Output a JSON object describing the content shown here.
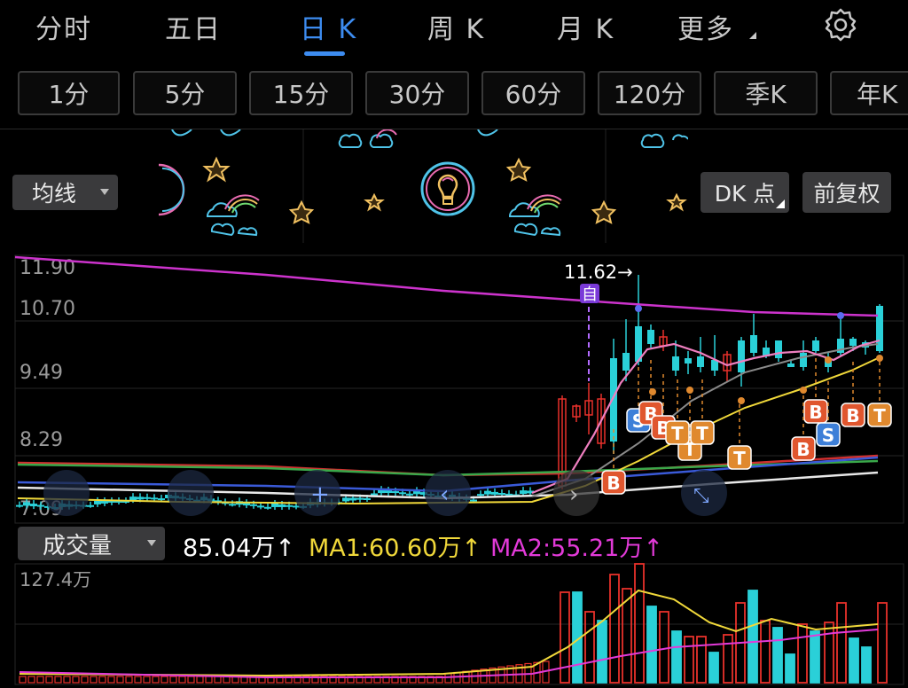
{
  "tabs": [
    {
      "label": "分时"
    },
    {
      "label": "五日"
    },
    {
      "label": "日 K",
      "active": true
    },
    {
      "label": "周 K"
    },
    {
      "label": "月 K"
    },
    {
      "label": "更多"
    }
  ],
  "periods": [
    "1分",
    "5分",
    "15分",
    "30分",
    "60分",
    "120分",
    "季K",
    "年K"
  ],
  "ma_select": "均线",
  "dk_button": "DK 点",
  "fq_button": "前复权",
  "price_axis": [
    "11.90",
    "10.70",
    "9.49",
    "8.29",
    "7.09"
  ],
  "peak_label": "11.62→",
  "zi_label": "自",
  "volume": {
    "selector": "成交量",
    "current": "85.04万↑",
    "ma1": "MA1:60.60万↑",
    "ma2": "MA2:55.21万↑",
    "max": "127.4万"
  },
  "signals": [
    {
      "t": "S",
      "c": "#3d7fd8"
    },
    {
      "t": "B",
      "c": "#e0562e"
    },
    {
      "t": "B",
      "c": "#e0562e"
    },
    {
      "t": "T",
      "c": "#e0892e"
    },
    {
      "t": "T",
      "c": "#e0892e"
    },
    {
      "t": "T",
      "c": "#e0892e"
    },
    {
      "t": "B",
      "c": "#e0562e"
    },
    {
      "t": "T",
      "c": "#e0892e"
    },
    {
      "t": "B",
      "c": "#e0562e"
    },
    {
      "t": "S",
      "c": "#3d7fd8"
    },
    {
      "t": "B",
      "c": "#e0562e"
    },
    {
      "t": "T",
      "c": "#e0892e"
    },
    {
      "t": "B",
      "c": "#e0562e"
    }
  ],
  "colors": {
    "up": "#e8312b",
    "down": "#2ad0d8",
    "ma_yellow": "#f0d83a",
    "ma_pink": "#ef7fc0",
    "ma_purple": "#cc33cc",
    "accent": "#3d8cf0"
  }
}
